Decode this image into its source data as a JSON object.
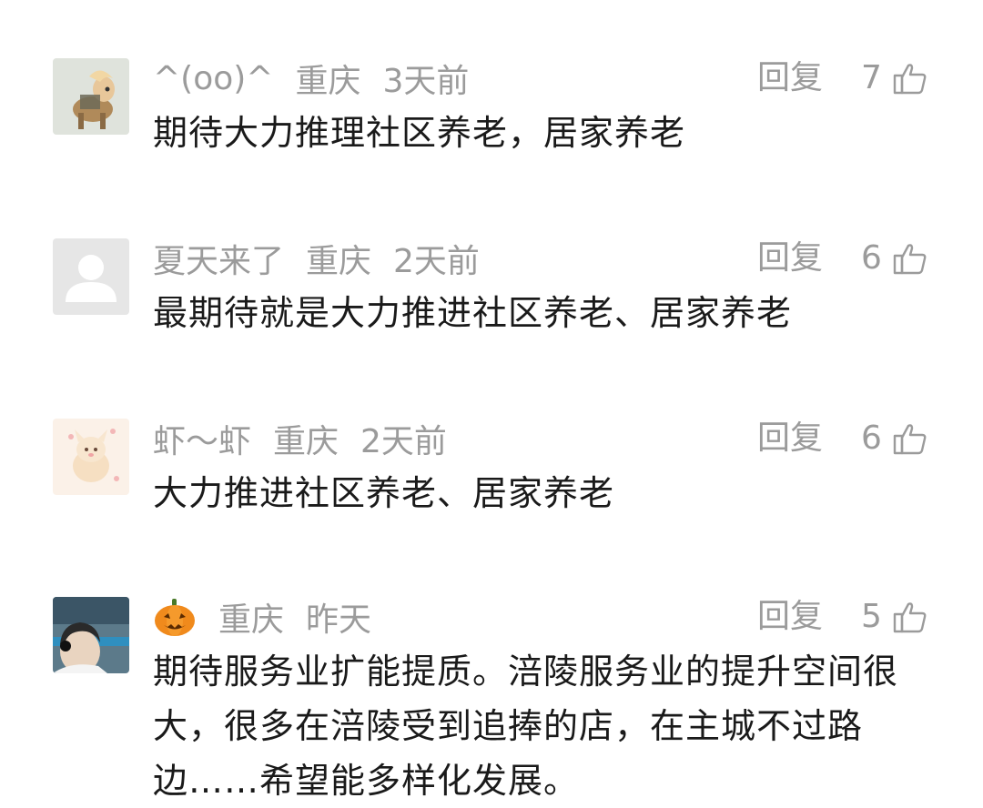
{
  "comments": [
    {
      "username": "^(oo)^",
      "location": "重庆",
      "time": "3天前",
      "reply_label": "回复",
      "likes": "7",
      "text": "期待大力推理社区养老，居家养老",
      "avatar_icon": "pony-avatar"
    },
    {
      "username": "夏天来了",
      "location": "重庆",
      "time": "2天前",
      "reply_label": "回复",
      "likes": "6",
      "text": "最期待就是大力推进社区养老、居家养老",
      "avatar_icon": "default-user-avatar"
    },
    {
      "username": "虾～虾",
      "location": "重庆",
      "time": "2天前",
      "reply_label": "回复",
      "likes": "6",
      "text": "大力推进社区养老、居家养老",
      "avatar_icon": "cartoon-avatar"
    },
    {
      "username_emoji": "pumpkin-icon",
      "location": "重庆",
      "time": "昨天",
      "reply_label": "回复",
      "likes": "5",
      "text": "期待服务业扩能提质。涪陵服务业的提升空间很大，很多在涪陵受到追捧的店，在主城不过路边……希望能多样化发展。",
      "avatar_icon": "photo-avatar"
    }
  ],
  "colors": {
    "meta_gray": "#9b9b9b",
    "text_dark": "#1a1a1a",
    "background": "#ffffff"
  }
}
